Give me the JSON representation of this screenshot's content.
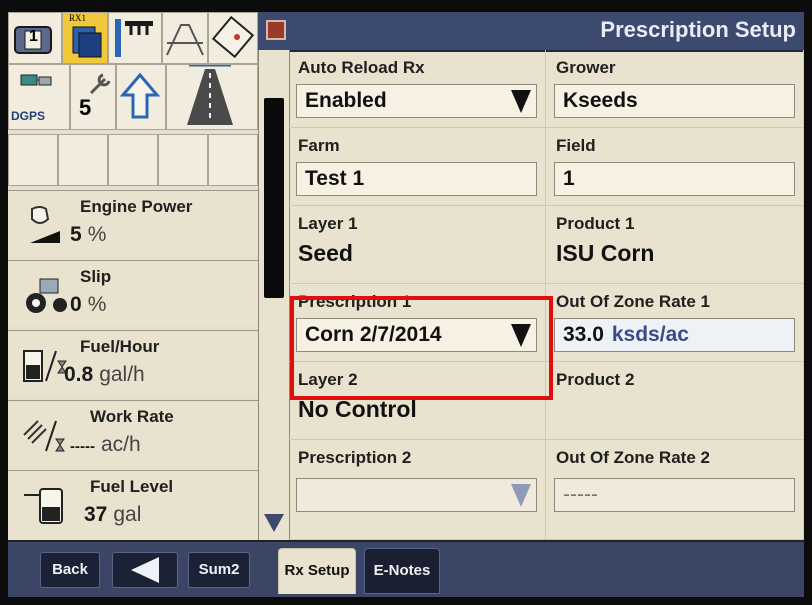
{
  "header": {
    "title": "Prescription Setup"
  },
  "status_icons": {
    "rx_badge": "RX1",
    "dgps_label": "DGPS",
    "satellite_count": "5",
    "tile_number": "1"
  },
  "left_stats": [
    {
      "title": "Engine Power",
      "value": "5",
      "unit": "%",
      "icon": "engine-icon"
    },
    {
      "title": "Slip",
      "value": "0",
      "unit": "%",
      "icon": "tractor-slip-icon"
    },
    {
      "title": "Fuel/Hour",
      "value": "0.8",
      "unit": "gal/h",
      "icon": "fuel-rate-icon"
    },
    {
      "title": "Work Rate",
      "value": "-----",
      "unit": "ac/h",
      "icon": "work-rate-icon"
    },
    {
      "title": "Fuel Level",
      "value": "37",
      "unit": "gal",
      "icon": "fuel-pump-icon"
    }
  ],
  "form": {
    "auto_reload": {
      "label": "Auto Reload Rx",
      "value": "Enabled"
    },
    "grower": {
      "label": "Grower",
      "value": "Kseeds"
    },
    "farm": {
      "label": "Farm",
      "value": "Test 1"
    },
    "field": {
      "label": "Field",
      "value": "1"
    },
    "layer1": {
      "label": "Layer 1",
      "value": "Seed"
    },
    "product1": {
      "label": "Product 1",
      "value": "ISU Corn"
    },
    "prescription1": {
      "label": "Prescription 1",
      "value": "Corn 2/7/2014"
    },
    "out_of_zone1": {
      "label": "Out Of Zone Rate 1",
      "value": "33.0",
      "unit": "ksds/ac"
    },
    "layer2": {
      "label": "Layer 2",
      "value": "No Control"
    },
    "product2": {
      "label": "Product 2",
      "value": ""
    },
    "prescription2": {
      "label": "Prescription 2",
      "value": ""
    },
    "out_of_zone2": {
      "label": "Out Of Zone Rate 2",
      "value": "-----"
    }
  },
  "bottom_bar": {
    "back_label": "Back",
    "sum2_label": "Sum2",
    "tabs": [
      {
        "label": "Rx Setup",
        "active": true
      },
      {
        "label": "E-Notes",
        "active": false
      }
    ]
  },
  "colors": {
    "highlight": "#e10e0e",
    "header_bg": "#3d4a70",
    "panel_bg": "#e9e2cf"
  }
}
